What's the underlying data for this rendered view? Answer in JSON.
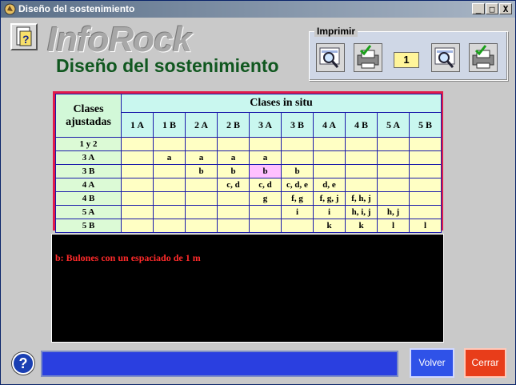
{
  "window": {
    "title": "Diseño del sostenimiento",
    "controls": [
      "_",
      "□",
      "X"
    ]
  },
  "logo": "InfoRock",
  "page_title": "Diseño del sostenimiento",
  "print": {
    "legend": "Imprimir",
    "copies": "1",
    "buttons": [
      "preview-icon",
      "printer-icon",
      "preview-icon",
      "printer-icon"
    ]
  },
  "table": {
    "row_header": "Clases ajustadas",
    "col_header": "Clases in situ",
    "columns": [
      "1 A",
      "1 B",
      "2 A",
      "2 B",
      "3 A",
      "3 B",
      "4 A",
      "4 B",
      "5 A",
      "5 B"
    ],
    "rows": [
      {
        "label": "1 y 2",
        "cells": [
          "",
          "",
          "",
          "",
          "",
          "",
          "",
          "",
          "",
          ""
        ]
      },
      {
        "label": "3 A",
        "cells": [
          "",
          "a",
          "a",
          "a",
          "a",
          "",
          "",
          "",
          "",
          ""
        ]
      },
      {
        "label": "3 B",
        "cells": [
          "",
          "",
          "b",
          "b",
          "b",
          "b",
          "",
          "",
          "",
          ""
        ]
      },
      {
        "label": "4 A",
        "cells": [
          "",
          "",
          "",
          "c, d",
          "c, d",
          "c, d, e",
          "d, e",
          "",
          "",
          ""
        ]
      },
      {
        "label": "4 B",
        "cells": [
          "",
          "",
          "",
          "",
          "g",
          "f, g",
          "f, g, j",
          "f, h, j",
          "",
          ""
        ]
      },
      {
        "label": "5 A",
        "cells": [
          "",
          "",
          "",
          "",
          "",
          "i",
          "i",
          "h, i, j",
          "h, j",
          ""
        ]
      },
      {
        "label": "5 B",
        "cells": [
          "",
          "",
          "",
          "",
          "",
          "",
          "k",
          "k",
          "l",
          "l"
        ]
      }
    ],
    "highlight": {
      "row": 2,
      "col": 4,
      "color": "#ffc0ff"
    }
  },
  "info_text": "b: Bulones con un espaciado de 1 m",
  "status_text": "",
  "buttons": {
    "help": "?",
    "volver": "Volver",
    "cerrar": "Cerrar"
  },
  "colors": {
    "title_green": "#10571f",
    "table_border": "#e11b4a",
    "cell_bg": "#ffffc4",
    "volver_bg": "#2f52e8",
    "cerrar_bg": "#e83d1a"
  }
}
